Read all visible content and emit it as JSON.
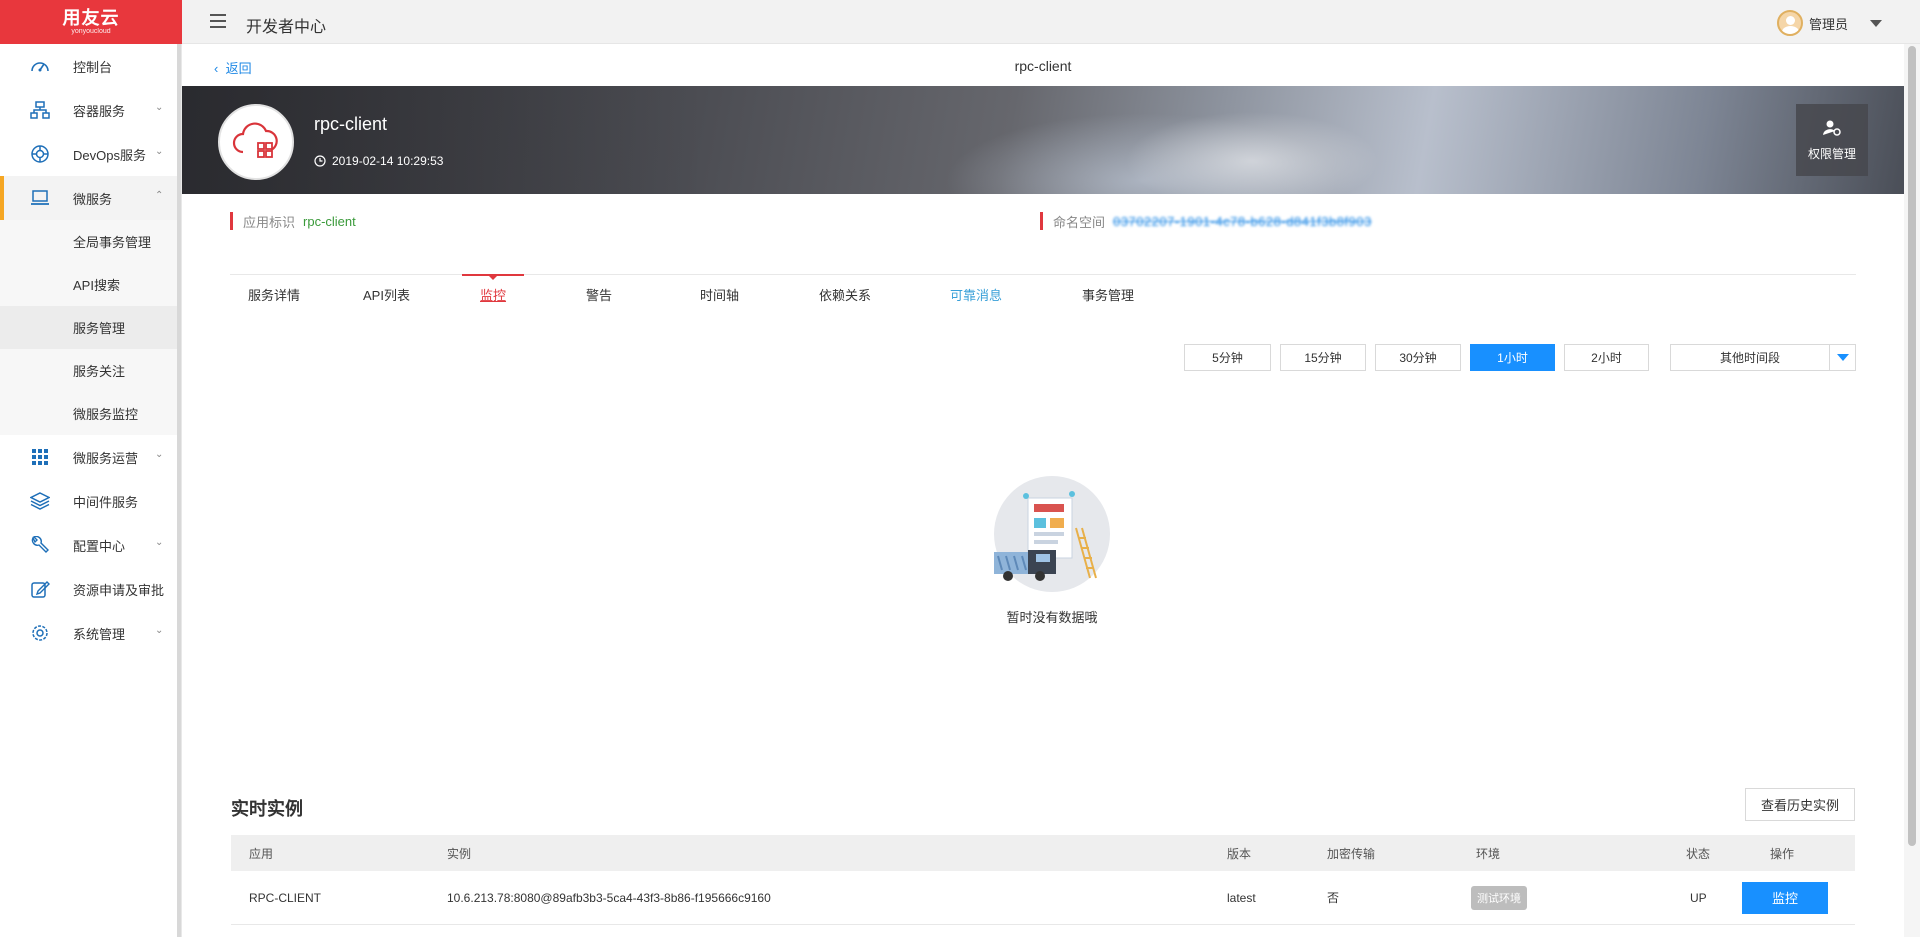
{
  "logo": {
    "main": "用友云",
    "sub": "yonyoucloud"
  },
  "header": {
    "title": "开发者中心",
    "user": "管理员"
  },
  "sidebar": {
    "items": [
      {
        "label": "控制台"
      },
      {
        "label": "容器服务"
      },
      {
        "label": "DevOps服务"
      },
      {
        "label": "微服务"
      },
      {
        "label": "微服务运营"
      },
      {
        "label": "中间件服务"
      },
      {
        "label": "配置中心"
      },
      {
        "label": "资源申请及审批"
      },
      {
        "label": "系统管理"
      }
    ],
    "sub_items": [
      {
        "label": "全局事务管理"
      },
      {
        "label": "API搜索"
      },
      {
        "label": "服务管理"
      },
      {
        "label": "服务关注"
      },
      {
        "label": "微服务监控"
      }
    ]
  },
  "subheader": {
    "back": "返回",
    "title": "rpc-client"
  },
  "app": {
    "name": "rpc-client",
    "time": "2019-02-14 10:29:53",
    "perm_label": "权限管理"
  },
  "meta": {
    "id_label": "应用标识",
    "id_value": "rpc-client",
    "ns_label": "命名空间",
    "ns_value": "03702207-1901-4c78-b628-d841f3b8f903"
  },
  "tabs": [
    {
      "label": "服务详情"
    },
    {
      "label": "API列表"
    },
    {
      "label": "监控"
    },
    {
      "label": "警告"
    },
    {
      "label": "时间轴"
    },
    {
      "label": "依赖关系"
    },
    {
      "label": "可靠消息"
    },
    {
      "label": "事务管理"
    }
  ],
  "time_ranges": [
    {
      "label": "5分钟"
    },
    {
      "label": "15分钟"
    },
    {
      "label": "30分钟"
    },
    {
      "label": "1小时"
    },
    {
      "label": "2小时"
    }
  ],
  "time_range_selected": "1小时",
  "time_other": "其他时间段",
  "empty_text": "暂时没有数据哦",
  "instances": {
    "title": "实时实例",
    "history_button": "查看历史实例",
    "columns": [
      "应用",
      "实例",
      "版本",
      "加密传输",
      "环境",
      "状态",
      "操作"
    ],
    "rows": [
      {
        "app": "RPC-CLIENT",
        "instance": "10.6.213.78:8080@89afb3b3-5ca4-43f3-8b86-f195666c9160",
        "version": "latest",
        "encrypted": "否",
        "env": "测试环境",
        "status": "UP",
        "action": "监控"
      }
    ]
  },
  "colors": {
    "brand": "#e8373d",
    "primary": "#1890ff",
    "active_nav": "#f5a623",
    "green": "#3a9a3a"
  }
}
